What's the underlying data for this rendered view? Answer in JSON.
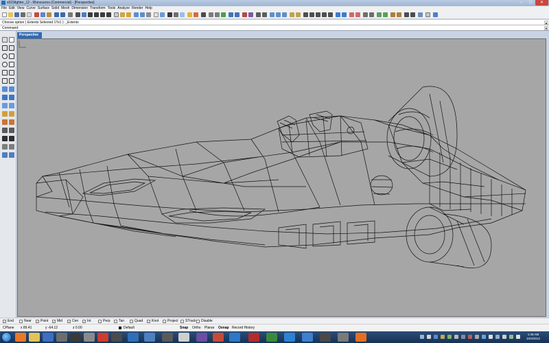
{
  "window": {
    "title": "x015fighter_12 - Rhinoceros (Commercial) - [Perspective]",
    "controls": {
      "minimize": "–",
      "maximize": "□",
      "close": "✕"
    }
  },
  "menu": [
    "File",
    "Edit",
    "View",
    "Curve",
    "Surface",
    "Solid",
    "Mesh",
    "Dimension",
    "Transform",
    "Tools",
    "Analyze",
    "Render",
    "Help"
  ],
  "command": {
    "history": "Choose option ( Extents  Selected  1To1 ): _Extents",
    "prompt_label": "Command:",
    "input_value": ""
  },
  "viewport": {
    "tab_label": "Perspective",
    "background": "#a6a6a6",
    "wire_color": "#111111"
  },
  "osnap": [
    {
      "label": "End",
      "checked": true
    },
    {
      "label": "Near",
      "checked": false
    },
    {
      "label": "Point",
      "checked": true
    },
    {
      "label": "Mid",
      "checked": true
    },
    {
      "label": "Cen",
      "checked": true
    },
    {
      "label": "Int",
      "checked": true
    },
    {
      "label": "Perp",
      "checked": false
    },
    {
      "label": "Tan",
      "checked": false
    },
    {
      "label": "Quad",
      "checked": false
    },
    {
      "label": "Knot",
      "checked": true
    },
    {
      "label": "Project",
      "checked": false
    },
    {
      "label": "STrack",
      "checked": false
    },
    {
      "label": "Disable",
      "checked": false
    }
  ],
  "status": {
    "cplane": "CPlane",
    "x": "x 89.41",
    "y": "y -64.12",
    "z": "z 0.00",
    "layer": "Default",
    "panes": [
      {
        "label": "Snap",
        "active": true
      },
      {
        "label": "Ortho",
        "active": false
      },
      {
        "label": "Planar",
        "active": false
      },
      {
        "label": "Osnap",
        "active": true
      },
      {
        "label": "Record History",
        "active": false
      }
    ]
  },
  "taskbar": {
    "apps": [
      "firefox-icon",
      "folder-icon",
      "media-player-icon",
      "film-icon",
      "chrome-icon",
      "photoshop-icon",
      "paint-icon",
      "app-icon",
      "rhino-icon",
      "pdf-icon",
      "folder2-icon",
      "lightroom-icon",
      "zbrush-icon",
      "maya-icon",
      "arduino-icon",
      "itunes-icon",
      "firefox2-icon",
      "app2-icon",
      "ie-icon",
      "app3-icon",
      "app4-icon",
      "app5-icon",
      "app6-icon"
    ],
    "time": "1:46 AM",
    "date": "10/4/2012"
  },
  "colors": {
    "titlebar": "#b9cbe2",
    "viewport_tab": "#2f6bb6",
    "close_button": "#c9463d",
    "taskbar": "#1f3f66"
  }
}
